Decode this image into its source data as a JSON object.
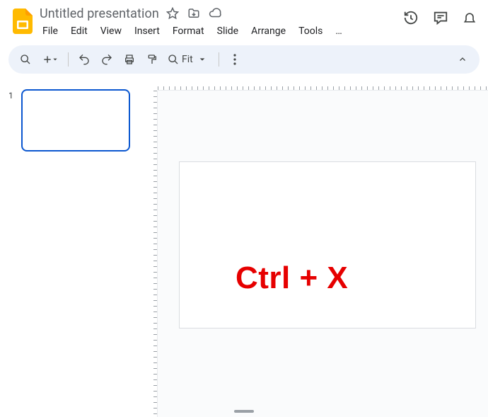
{
  "doc": {
    "title": "Untitled presentation"
  },
  "menu": {
    "file": "File",
    "edit": "Edit",
    "view": "View",
    "insert": "Insert",
    "format": "Format",
    "slide": "Slide",
    "arrange": "Arrange",
    "tools": "Tools",
    "more": "…"
  },
  "toolbar": {
    "zoom_label": "Fit"
  },
  "slides": {
    "current_number": "1"
  },
  "overlay": {
    "shortcut": "Ctrl + X"
  }
}
